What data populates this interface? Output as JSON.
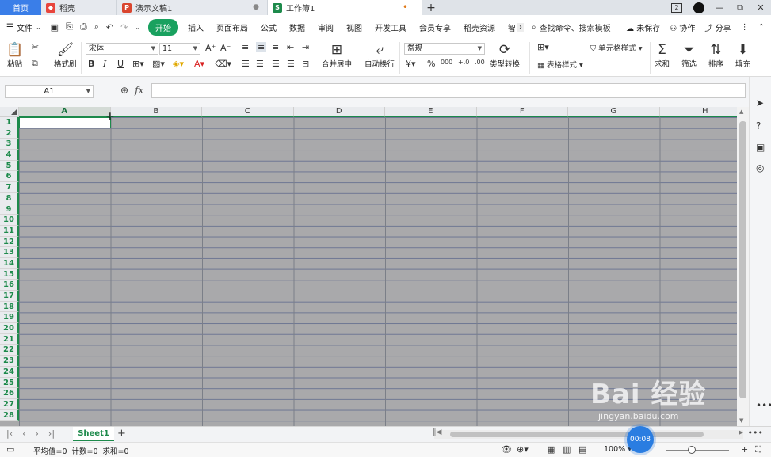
{
  "tabs": {
    "home": "首页",
    "tab1": "稻壳",
    "tab2": "演示文稿1",
    "tab3": "工作簿1",
    "add": "+"
  },
  "window": {
    "badge": "2",
    "minimize": "—",
    "restore": "⧉",
    "close": "✕"
  },
  "menu": {
    "file": "文件",
    "start": "开始",
    "items": [
      "插入",
      "页面布局",
      "公式",
      "数据",
      "审阅",
      "视图",
      "开发工具",
      "会员专享",
      "稻壳资源",
      "智"
    ],
    "search": "查找命令、搜索模板",
    "unsaved": "未保存",
    "collab": "协作",
    "share": "分享"
  },
  "ribbon": {
    "paste": "粘贴",
    "format_painter": "格式刷",
    "font_name": "宋体",
    "font_size": "11",
    "merge": "合并居中",
    "wrap": "自动换行",
    "number_format": "常规",
    "type_convert": "类型转换",
    "cond_format": "条件格式",
    "cell_style": "单元格样式",
    "table_style": "表格样式",
    "sum": "求和",
    "filter": "筛选",
    "sort": "排序",
    "fill": "填充",
    "currency": "¥",
    "percent": "%",
    "thousands": "000",
    "dec_inc": "+.0",
    "dec_dec": ".00"
  },
  "formula_bar": {
    "name_box": "A1",
    "fx": "fx"
  },
  "columns": [
    "A",
    "B",
    "C",
    "D",
    "E",
    "F",
    "G",
    "H"
  ],
  "rows": [
    "1",
    "2",
    "3",
    "4",
    "5",
    "6",
    "7",
    "8",
    "9",
    "10",
    "11",
    "12",
    "13",
    "14",
    "15",
    "16",
    "17",
    "18",
    "19",
    "20",
    "21",
    "22",
    "23",
    "24",
    "25",
    "26",
    "27",
    "28"
  ],
  "sheet": {
    "name": "Sheet1",
    "add": "+"
  },
  "status": {
    "average": "平均值=0",
    "count": "计数=0",
    "sum": "求和=0",
    "zoom": "100%",
    "timer": "00:08"
  },
  "watermark": {
    "main": "Bai 经验",
    "sub": "jingyan.baidu.com"
  },
  "colors": {
    "accent": "#1d8a4b",
    "home_tab": "#3a7ee8",
    "start_pill": "#19a15f",
    "grid_fill": "#a9a9ab"
  }
}
